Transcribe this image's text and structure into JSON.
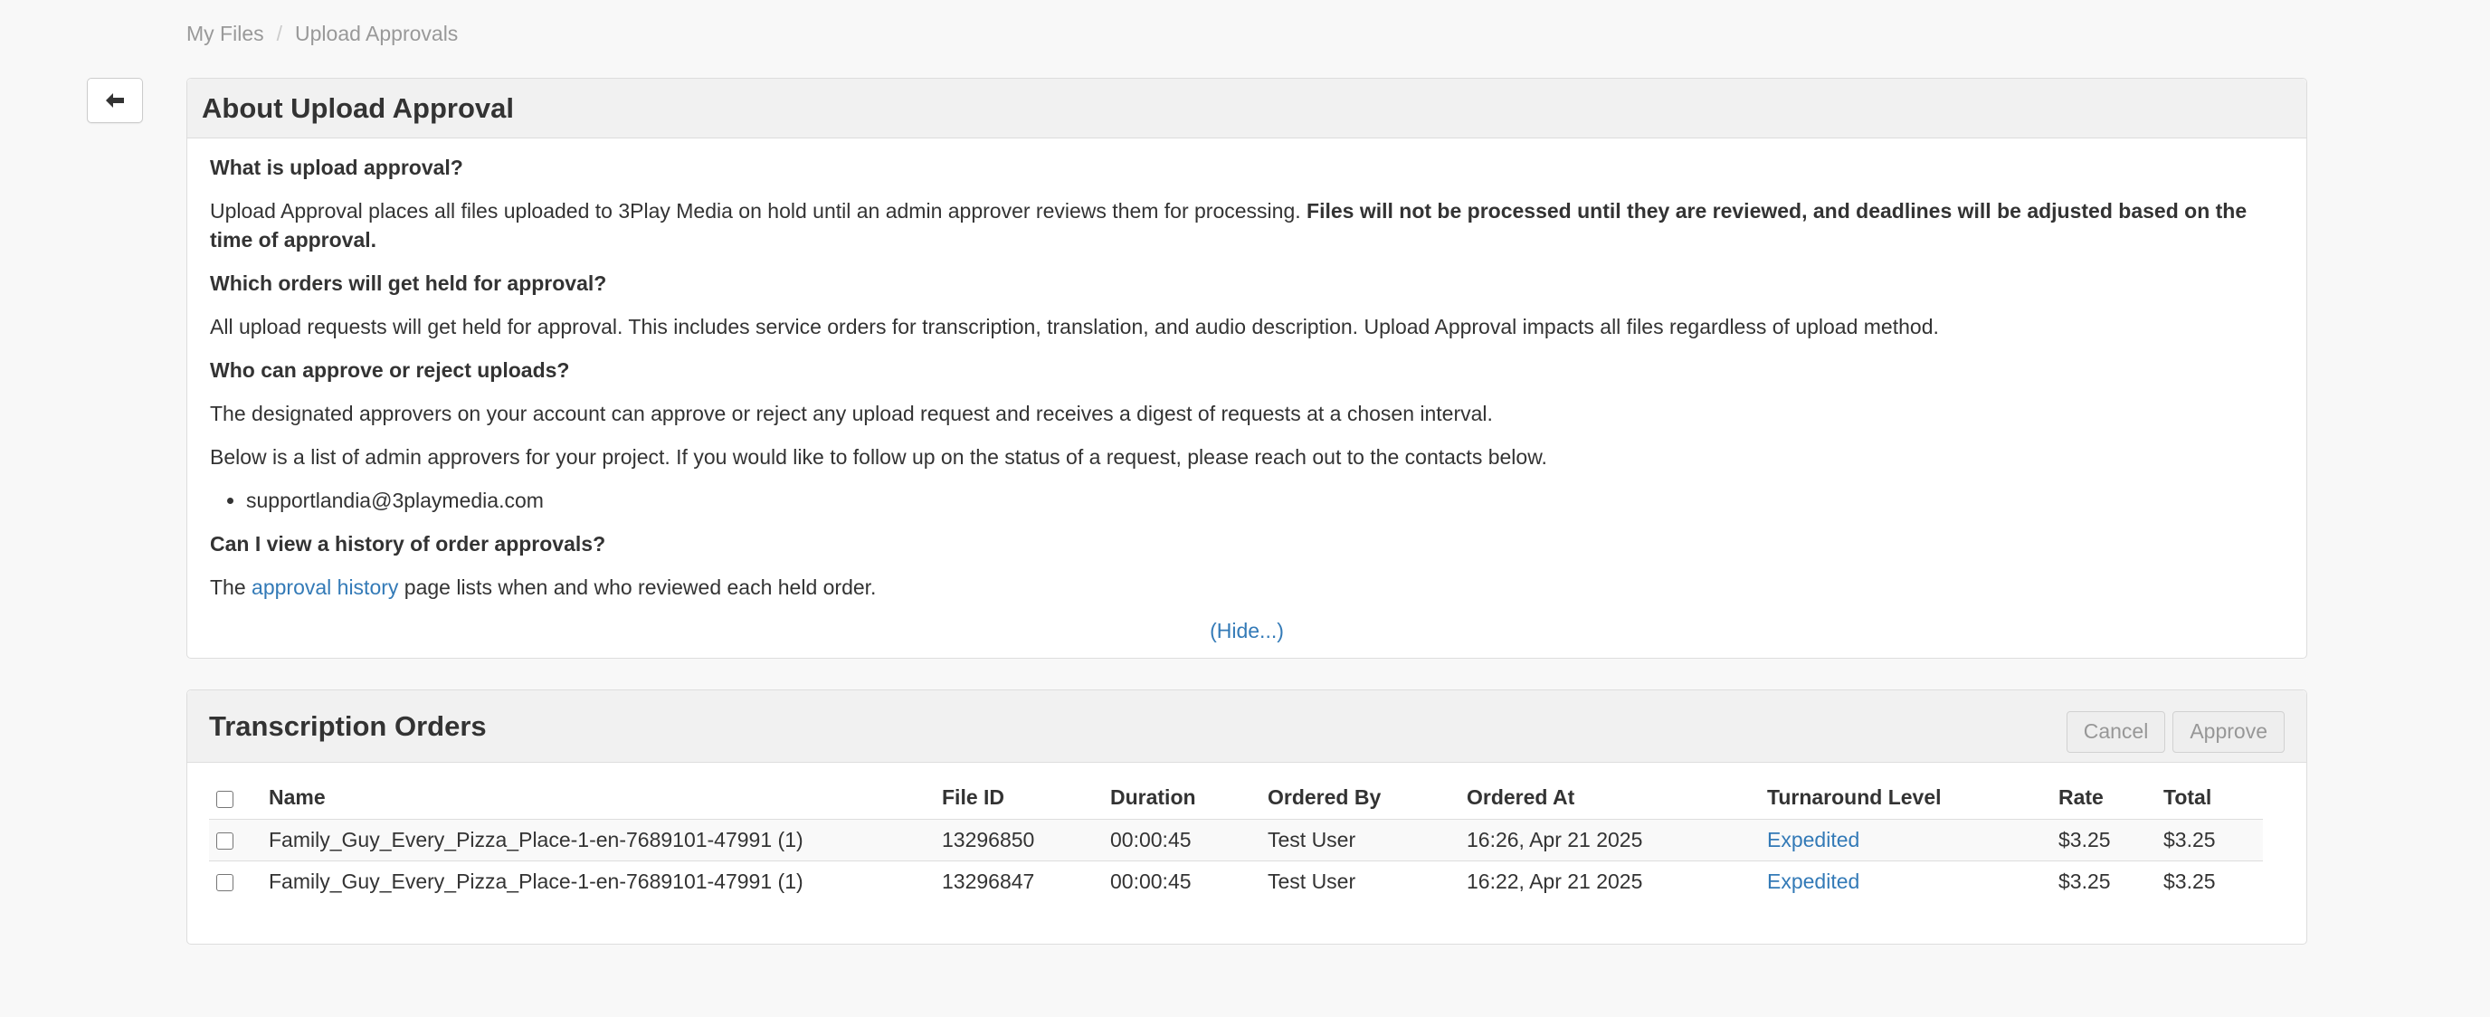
{
  "breadcrumb": {
    "root": "My Files",
    "separator": "/",
    "current": "Upload Approvals"
  },
  "back_button": {
    "icon": "arrow-left-icon"
  },
  "about": {
    "title": "About Upload Approval",
    "q1": "What is upload approval?",
    "a1_text": "Upload Approval places all files uploaded to 3Play Media on hold until an admin approver reviews them for processing.",
    "a1_bold": "Files will not be processed until they are reviewed, and deadlines will be adjusted based on the time of approval.",
    "q2": "Which orders will get held for approval?",
    "a2": "All upload requests will get held for approval. This includes service orders for transcription, translation, and audio description. Upload Approval impacts all files regardless of upload method.",
    "q3": "Who can approve or reject uploads?",
    "a3": "The designated approvers on your account can approve or reject any upload request and receives a digest of requests at a chosen interval.",
    "a3b": "Below is a list of admin approvers for your project. If you would like to follow up on the status of a request, please reach out to the contacts below.",
    "contacts": [
      "supportlandia@3playmedia.com"
    ],
    "q4": "Can I view a history of order approvals?",
    "a4_prefix": "The",
    "a4_link": "approval history",
    "a4_suffix": "page lists when and who reviewed each held order.",
    "hide_link": "(Hide...)"
  },
  "orders": {
    "title": "Transcription Orders",
    "cancel_label": "Cancel",
    "approve_label": "Approve",
    "columns": [
      "Name",
      "File ID",
      "Duration",
      "Ordered By",
      "Ordered At",
      "Turnaround Level",
      "Rate",
      "Total"
    ],
    "rows": [
      {
        "name": "Family_Guy_Every_Pizza_Place-1-en-7689101-47991 (1)",
        "file_id": "13296850",
        "duration": "00:00:45",
        "ordered_by": "Test User",
        "ordered_at": "16:26, Apr 21 2025",
        "turnaround": "Expedited",
        "rate": "$3.25",
        "total": "$3.25"
      },
      {
        "name": "Family_Guy_Every_Pizza_Place-1-en-7689101-47991 (1)",
        "file_id": "13296847",
        "duration": "00:00:45",
        "ordered_by": "Test User",
        "ordered_at": "16:22, Apr 21 2025",
        "turnaround": "Expedited",
        "rate": "$3.25",
        "total": "$3.25"
      }
    ]
  },
  "colors": {
    "link": "#337ab7",
    "background": "#f8f8f8",
    "panel_heading": "#f1f1f1"
  }
}
